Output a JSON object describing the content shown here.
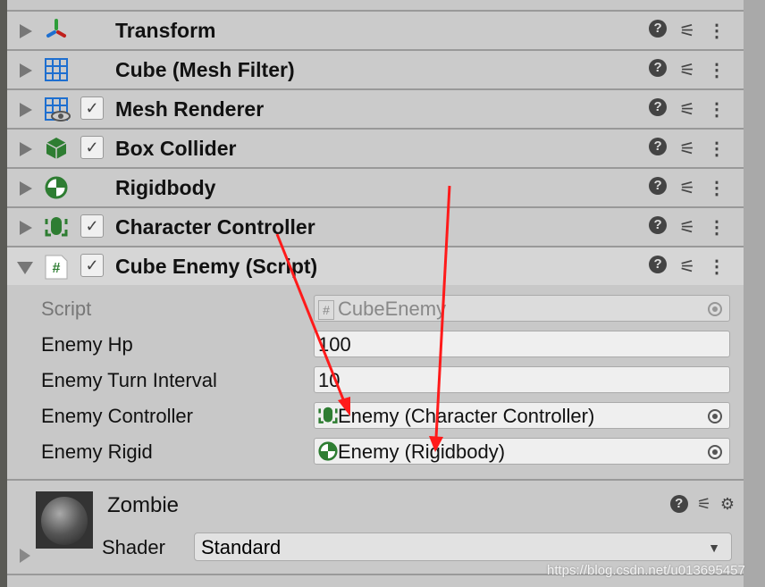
{
  "components": [
    {
      "title": "Transform",
      "icon": "transform-icon",
      "checkbox": false
    },
    {
      "title": "Cube (Mesh Filter)",
      "icon": "mesh-filter-icon",
      "checkbox": false
    },
    {
      "title": "Mesh Renderer",
      "icon": "mesh-renderer-icon",
      "checkbox": true
    },
    {
      "title": "Box Collider",
      "icon": "box-collider-icon",
      "checkbox": true
    },
    {
      "title": "Rigidbody",
      "icon": "rigidbody-icon",
      "checkbox": false
    },
    {
      "title": "Character Controller",
      "icon": "character-controller-icon",
      "checkbox": true
    },
    {
      "title": "Cube Enemy (Script)",
      "icon": "script-icon",
      "checkbox": true,
      "expanded": true
    }
  ],
  "fields": [
    {
      "label": "Script",
      "value": "CubeEnemy",
      "disabled": true
    },
    {
      "label": "Enemy Hp",
      "value": "100"
    },
    {
      "label": "Enemy Turn Interval",
      "value": "10"
    },
    {
      "label": "Enemy Controller",
      "value": "Enemy (Character Controller)"
    },
    {
      "label": "Enemy Rigid",
      "value": "Enemy (Rigidbody)"
    }
  ],
  "material": {
    "name": "Zombie",
    "shader_label": "Shader",
    "shader": "Standard"
  },
  "watermark": "https://blog.csdn.net/u013695457",
  "colors": {
    "accent_green": "#2e7d32",
    "accent_blue": "#1e6fd0",
    "arrow": "#ff1a1a"
  }
}
